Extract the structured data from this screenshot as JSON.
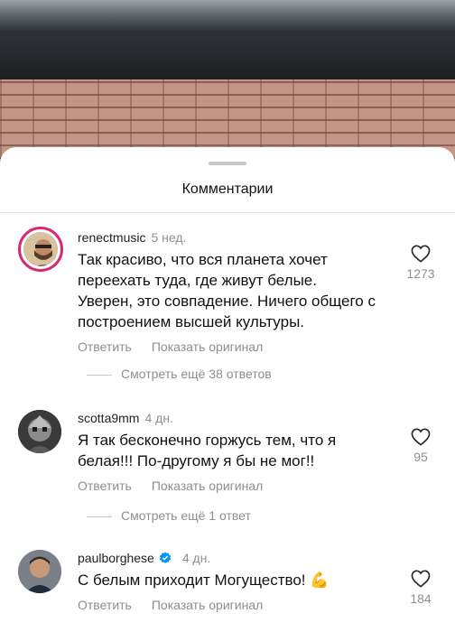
{
  "sheet": {
    "title": "Комментарии"
  },
  "comments": [
    {
      "username": "renectmusic",
      "time": "5 нед.",
      "text": "Так красиво, что вся планета хочет переехать туда, где живут белые. Уверен, это совпадение. Ничего общего с построением высшей культуры.",
      "reply_label": "Ответить",
      "translate_label": "Показать оригинал",
      "likes": "1273",
      "verified": false
    },
    {
      "username": "scotta9mm",
      "time": "4 дн.",
      "text": "Я так бесконечно горжусь тем, что я белая!!! По-другому я бы не мог!!",
      "reply_label": "Ответить",
      "translate_label": "Показать оригинал",
      "likes": "95",
      "verified": false
    },
    {
      "username": "paulborghese",
      "time": "4 дн.",
      "text": "С белым приходит Могущество! 💪",
      "reply_label": "Ответить",
      "translate_label": "Показать оригинал",
      "likes": "184",
      "verified": true
    }
  ],
  "view_replies": [
    {
      "label": "Смотреть ещё 38 ответов"
    },
    {
      "label": "Смотреть ещё 1 ответ"
    }
  ],
  "colors": {
    "accent_ring": "#d62976",
    "verified": "#0095f6",
    "muted": "#8e8e8e"
  }
}
